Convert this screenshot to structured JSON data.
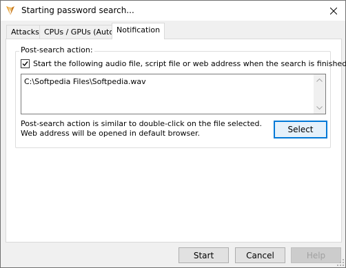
{
  "window": {
    "title": "Starting password search..."
  },
  "tabs": [
    {
      "label": "Attacks",
      "active": false
    },
    {
      "label": "CPUs / GPUs (Auto)",
      "active": false
    },
    {
      "label": "Notification",
      "active": true
    }
  ],
  "notification": {
    "group_label": "Post-search action:",
    "checkbox_label": "Start the following audio file, script file or web address when the search is finished.",
    "checkbox_checked": true,
    "path_value": "C:\\Softpedia Files\\Softpedia.wav",
    "info_line1": "Post-search action is similar to double-click on the file selected.",
    "info_line2": "Web address will be opened in default browser.",
    "select_label": "Select"
  },
  "footer": {
    "start_label": "Start",
    "cancel_label": "Cancel",
    "help_label": "Help"
  },
  "colors": {
    "accent": "#0078d7",
    "app_icon": "#e8a33c"
  },
  "icons": {
    "app": "app-logo-icon",
    "close": "close-icon",
    "checkbox": "checkmark-icon",
    "scroll_up": "chevron-up-icon",
    "scroll_down": "chevron-down-icon",
    "grip": "resize-grip-icon"
  }
}
